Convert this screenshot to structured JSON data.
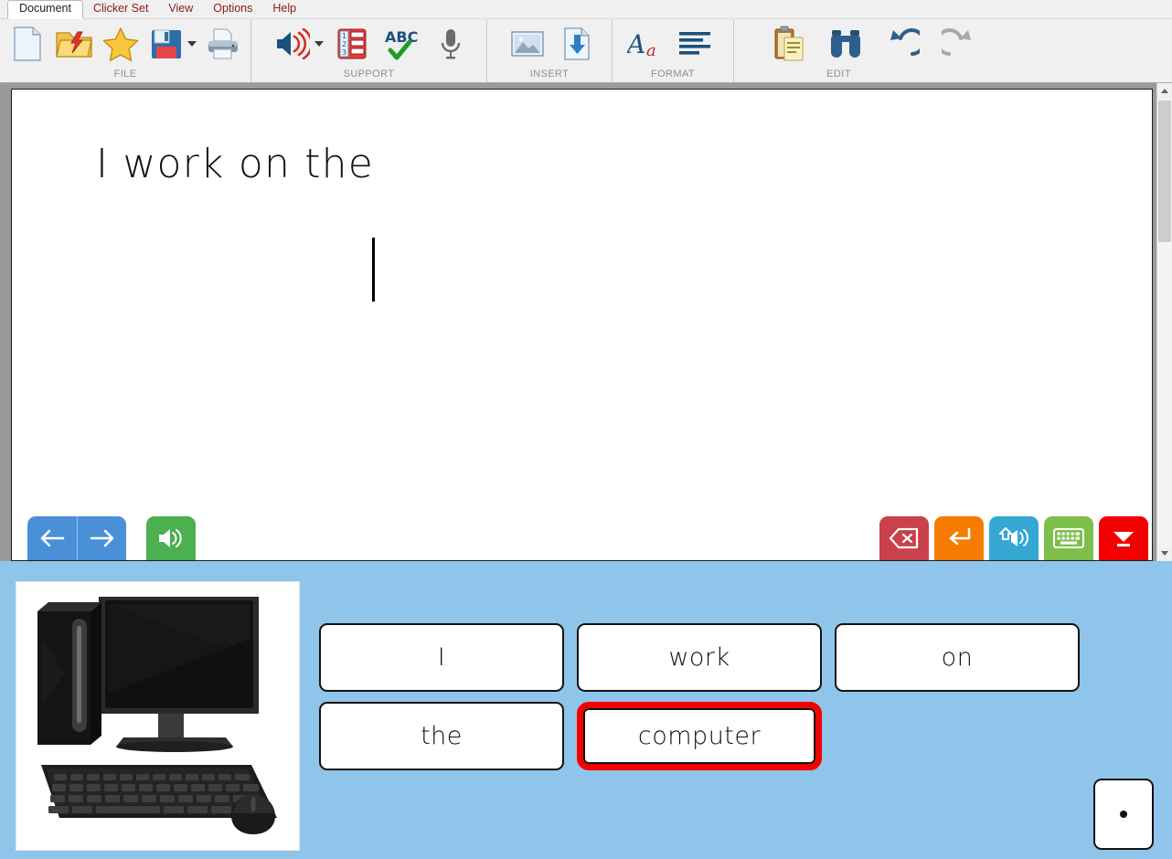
{
  "menu": {
    "tabs": [
      {
        "label": "Document",
        "name": "menu-tab-document",
        "active": true
      },
      {
        "label": "Clicker Set",
        "name": "menu-tab-clicker-set",
        "active": false
      },
      {
        "label": "View",
        "name": "menu-tab-view",
        "active": false
      },
      {
        "label": "Options",
        "name": "menu-tab-options",
        "active": false
      },
      {
        "label": "Help",
        "name": "menu-tab-help",
        "active": false
      }
    ]
  },
  "ribbon": {
    "groups": [
      {
        "label": "FILE",
        "buttons": [
          {
            "icon": "new-document-icon",
            "name": "new-document-button"
          },
          {
            "icon": "open-folder-icon",
            "name": "open-button"
          },
          {
            "icon": "star-icon",
            "name": "favourites-button"
          },
          {
            "icon": "save-icon",
            "name": "save-button",
            "caret": true
          },
          {
            "icon": "printer-icon",
            "name": "print-button"
          }
        ]
      },
      {
        "label": "SUPPORT",
        "buttons": [
          {
            "icon": "speaker-icon",
            "name": "speak-button",
            "caret": true
          },
          {
            "icon": "word-bank-icon",
            "name": "word-bank-button"
          },
          {
            "icon": "abc-check-icon",
            "name": "spell-check-button"
          },
          {
            "icon": "microphone-icon",
            "name": "voice-notes-button"
          }
        ]
      },
      {
        "label": "INSERT",
        "buttons": [
          {
            "icon": "picture-icon",
            "name": "insert-picture-button"
          },
          {
            "icon": "insert-page-icon",
            "name": "insert-page-button"
          }
        ]
      },
      {
        "label": "FORMAT",
        "buttons": [
          {
            "icon": "font-icon",
            "name": "font-button"
          },
          {
            "icon": "align-icon",
            "name": "paragraph-align-button"
          }
        ]
      },
      {
        "label": "EDIT",
        "buttons": [
          {
            "icon": "clipboard-icon",
            "name": "paste-button"
          },
          {
            "icon": "binoculars-icon",
            "name": "find-button"
          },
          {
            "icon": "undo-icon",
            "name": "undo-button"
          },
          {
            "icon": "redo-icon",
            "name": "redo-button"
          }
        ]
      }
    ]
  },
  "document": {
    "text": "I work on the ",
    "caret_visible": true
  },
  "page_toolbar": {
    "left": [
      {
        "icon": "arrow-left-icon",
        "name": "previous-page-button",
        "color": "#4A90D9"
      },
      {
        "icon": "arrow-right-icon",
        "name": "next-page-button",
        "color": "#4A90D9"
      },
      {
        "icon": "speaker-icon",
        "name": "read-aloud-button",
        "color": "#4CAF50"
      }
    ],
    "right": [
      {
        "icon": "backspace-icon",
        "name": "backspace-button",
        "color": "#C9414A"
      },
      {
        "icon": "enter-icon",
        "name": "enter-button",
        "color": "#F57C00"
      },
      {
        "icon": "speak-word-icon",
        "name": "speak-word-button",
        "color": "#35A7D3"
      },
      {
        "icon": "keyboard-icon",
        "name": "keyboard-button",
        "color": "#7DBF4A"
      },
      {
        "icon": "collapse-down-icon",
        "name": "hide-grid-button",
        "color": "#F30000"
      }
    ]
  },
  "scrollbar": {
    "up_arrow": "chevron-up-icon",
    "down_arrow": "chevron-down-icon"
  },
  "grid": {
    "picture_card": {
      "name": "picture-card-computer",
      "alt": "desktop-computer-image"
    },
    "rows": [
      [
        {
          "label": "I",
          "name": "word-card-i",
          "highlight": false
        },
        {
          "label": "work",
          "name": "word-card-work",
          "highlight": false
        },
        {
          "label": "on",
          "name": "word-card-on",
          "highlight": false
        }
      ],
      [
        {
          "label": "the",
          "name": "word-card-the",
          "highlight": false
        },
        {
          "label": "computer",
          "name": "word-card-computer",
          "highlight": true
        }
      ]
    ],
    "period_card": {
      "label": ".",
      "name": "punctuation-card-period"
    }
  },
  "colors": {
    "grid_background": "#8FC5EA",
    "highlight_border": "#F40000",
    "ribbon_background": "#F0F0F0",
    "document_surround": "#9A9A9A"
  }
}
